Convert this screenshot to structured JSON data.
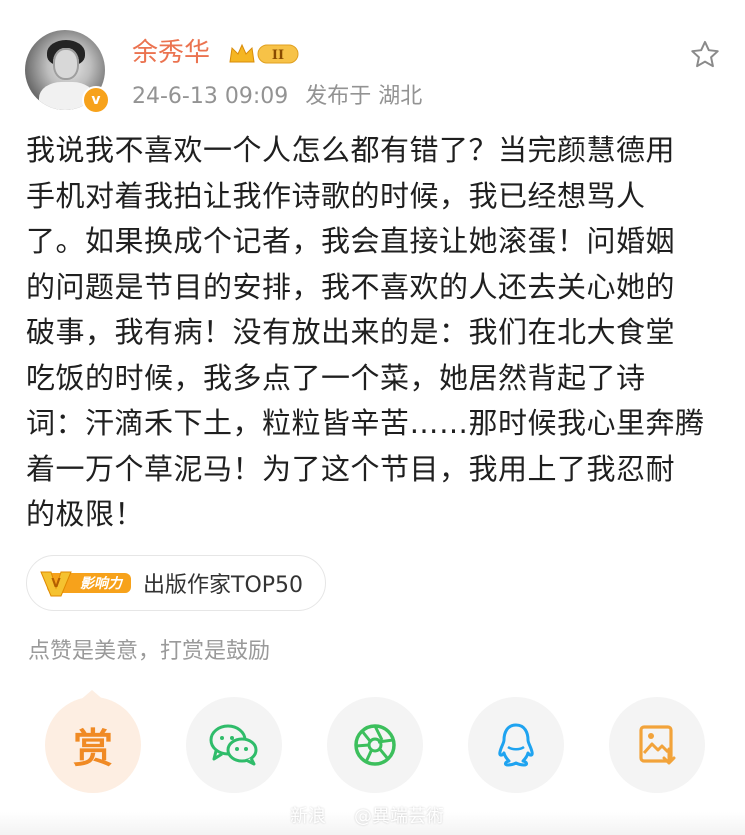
{
  "post": {
    "username": "余秀华",
    "vip_level": "II",
    "timestamp": "24-6-13 09:09",
    "location": "发布于 湖北",
    "content_lines": [
      "我说我不喜欢一个人怎么都有错了？当完颜慧德用",
      "手机对着我拍让我作诗歌的时候，我已经想骂人",
      "了。如果换成个记者，我会直接让她滚蛋！问婚姻",
      "的问题是节目的安排，我不喜欢的人还去关心她的",
      "破事，我有病！没有放出来的是：我们在北大食堂",
      "吃饭的时候，我多点了一个菜，她居然背起了诗",
      "词：汗滴禾下土，粒粒皆辛苦……那时候我心里奔腾",
      "着一万个草泥马！为了这个节目，我用上了我忍耐",
      "的极限！"
    ]
  },
  "influence_tag": {
    "badge_text": "影响力",
    "badge_letter": "V",
    "label": "出版作家TOP50"
  },
  "reward_note": "点赞是美意，打赏是鼓励",
  "actions": {
    "reward_label": "赏"
  },
  "watermark": {
    "site": "新浪",
    "handle": "@異端芸術"
  },
  "colors": {
    "username": "#eb7350",
    "meta": "#939393",
    "reward": "#f08a24",
    "wechat": "#2fbc6a",
    "moments": "#3cbf5c",
    "qq": "#1ea3f0",
    "save": "#f2a33a"
  }
}
